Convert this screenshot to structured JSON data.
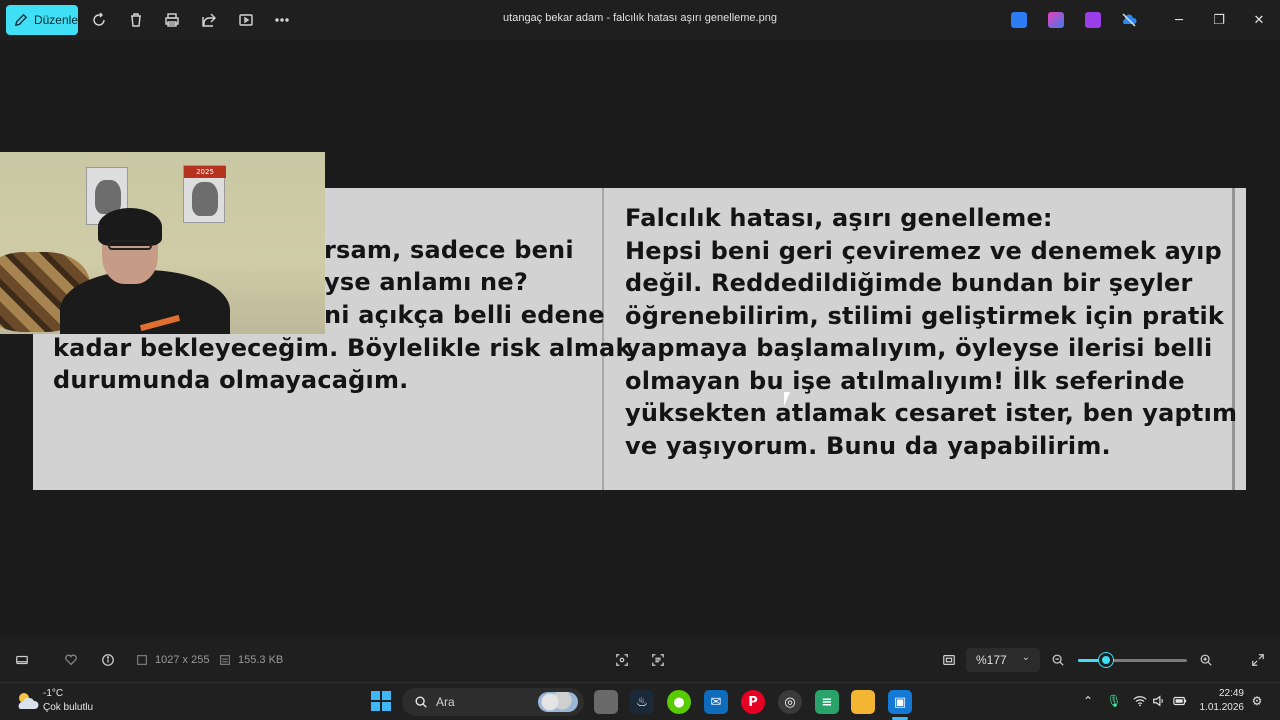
{
  "titlebar": {
    "edit_label": "Düzenle",
    "window_title": "utangaç bekar adam - falcılık hatası aşırı genelleme.png",
    "icons": [
      "rotate-icon",
      "delete-icon",
      "print-icon",
      "share-icon",
      "slideshow-icon",
      "more-icon"
    ],
    "window_controls": {
      "minimize": "─",
      "maximize": "❐",
      "close": "✕"
    }
  },
  "image_content": {
    "left_lines": [
      "rsam, sadece beni",
      "yse anlamı ne?",
      "ni açıkça belli edene",
      "kadar bekleyeceğim. Böylelikle risk almak",
      "durumunda olmayacağım."
    ],
    "right_heading": "Falcılık hatası, aşırı genelleme:",
    "right_lines": [
      "Hepsi beni geri çeviremez ve denemek ayıp",
      "değil. Reddedildiğimde bundan bir şeyler",
      "öğrenebilirim, stilimi geliştirmek için pratik",
      "yapmaya başlamalıyım, öyleyse ilerisi belli",
      "olmayan bu işe atılmalıyım! İlk seferinde",
      "yüksekten atlamak cesaret ister, ben yaptım",
      "ve yaşıyorum. Bunu da yapabilirim."
    ]
  },
  "webcam": {
    "poster_year": "2025"
  },
  "statusbar": {
    "dimensions": "1027 x 255",
    "file_size": "155.3 KB",
    "zoom": "%177",
    "zoom_slider_fraction": 0.26
  },
  "taskbar": {
    "weather_temp": "-1°C",
    "weather_desc": "Çok bulutlu",
    "search_placeholder": "Ara",
    "time": "22:49",
    "date": "1.01.2026"
  },
  "colors": {
    "accent": "#3fe0f5",
    "background": "#1c1c1c",
    "image_bg": "#d2d2d2"
  }
}
